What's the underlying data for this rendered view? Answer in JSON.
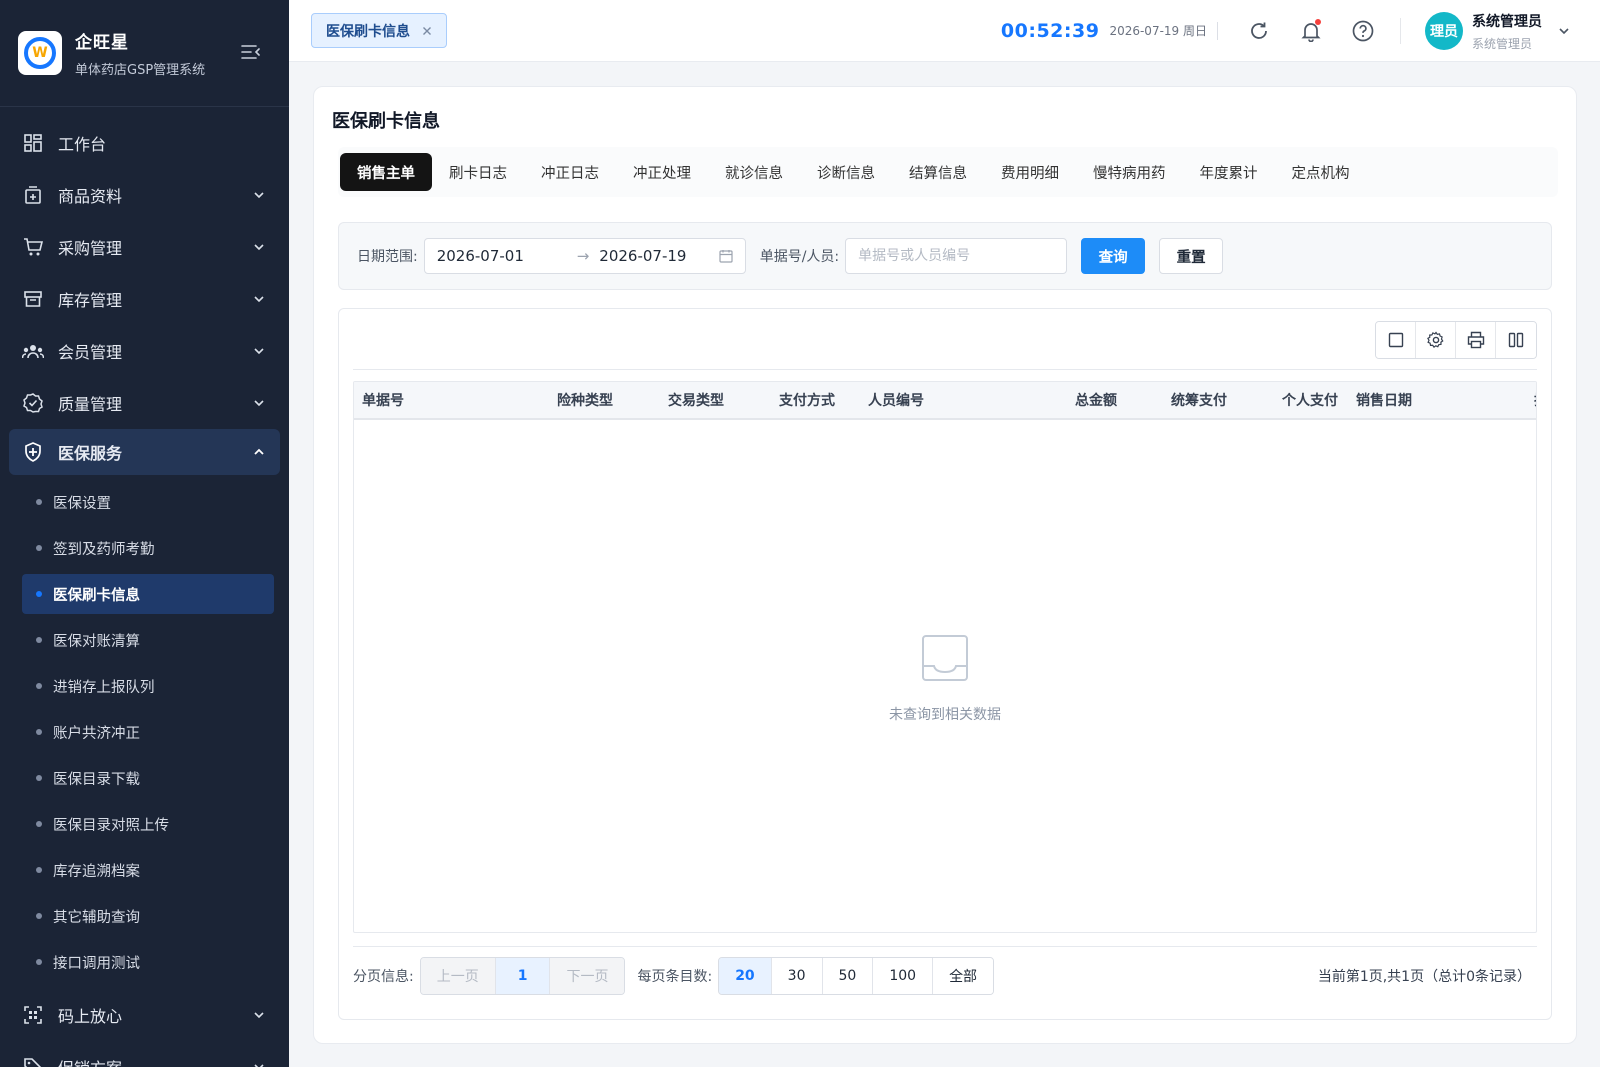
{
  "app": {
    "name": "企旺星",
    "subtitle": "单体药店GSP管理系统",
    "logo_letter": "W"
  },
  "sidebar": {
    "items": [
      {
        "label": "工作台",
        "icon": "dashboard-icon"
      },
      {
        "label": "商品资料",
        "icon": "product-icon"
      },
      {
        "label": "采购管理",
        "icon": "cart-icon"
      },
      {
        "label": "库存管理",
        "icon": "inventory-icon"
      },
      {
        "label": "会员管理",
        "icon": "members-icon"
      },
      {
        "label": "质量管理",
        "icon": "quality-icon"
      },
      {
        "label": "医保服务",
        "icon": "shield-icon"
      },
      {
        "label": "码上放心",
        "icon": "qrcode-icon"
      },
      {
        "label": "促销方案",
        "icon": "tag-icon"
      }
    ],
    "sub_items": [
      "医保设置",
      "签到及药师考勤",
      "医保刷卡信息",
      "医保对账清算",
      "进销存上报队列",
      "账户共济冲正",
      "医保目录下载",
      "医保目录对照上传",
      "库存追溯档案",
      "其它辅助查询",
      "接口调用测试"
    ],
    "active_sub": "医保刷卡信息"
  },
  "header": {
    "open_tab": "医保刷卡信息",
    "clock": "00:52:39",
    "date": "2026-07-19 周日",
    "user": {
      "avatar_text": "理员",
      "name": "系统管理员",
      "role": "系统管理员"
    }
  },
  "page": {
    "title": "医保刷卡信息",
    "tabs": [
      "销售主单",
      "刷卡日志",
      "冲正日志",
      "冲正处理",
      "就诊信息",
      "诊断信息",
      "结算信息",
      "费用明细",
      "慢特病用药",
      "年度累计",
      "定点机构"
    ],
    "active_tab": "销售主单"
  },
  "filter": {
    "date_label": "日期范围:",
    "date_from": "2026-07-01",
    "date_to": "2026-07-19",
    "date_separator": "→",
    "keyword_label": "单据号/人员:",
    "keyword_placeholder": "单据号或人员编号",
    "keyword_value": "",
    "search_btn": "查询",
    "reset_btn": "重置"
  },
  "table": {
    "columns": [
      "单据号",
      "险种类型",
      "交易类型",
      "支付方式",
      "人员编号",
      "总金额",
      "统筹支付",
      "个人支付",
      "销售日期",
      "操"
    ],
    "rows": [],
    "empty_text": "未查询到相关数据"
  },
  "pager": {
    "label": "分页信息:",
    "prev": "上一页",
    "current": "1",
    "next": "下一页",
    "size_label": "每页条目数:",
    "sizes": [
      "20",
      "30",
      "50",
      "100",
      "全部"
    ],
    "active_size": "20",
    "summary": "当前第1页,共1页（总计0条记录）"
  },
  "colors": {
    "accent": "#1677ff",
    "sidebar_bg": "#1b2436",
    "active_sub_bg": "#1f3a6b",
    "tab_active_bg": "#141414"
  }
}
